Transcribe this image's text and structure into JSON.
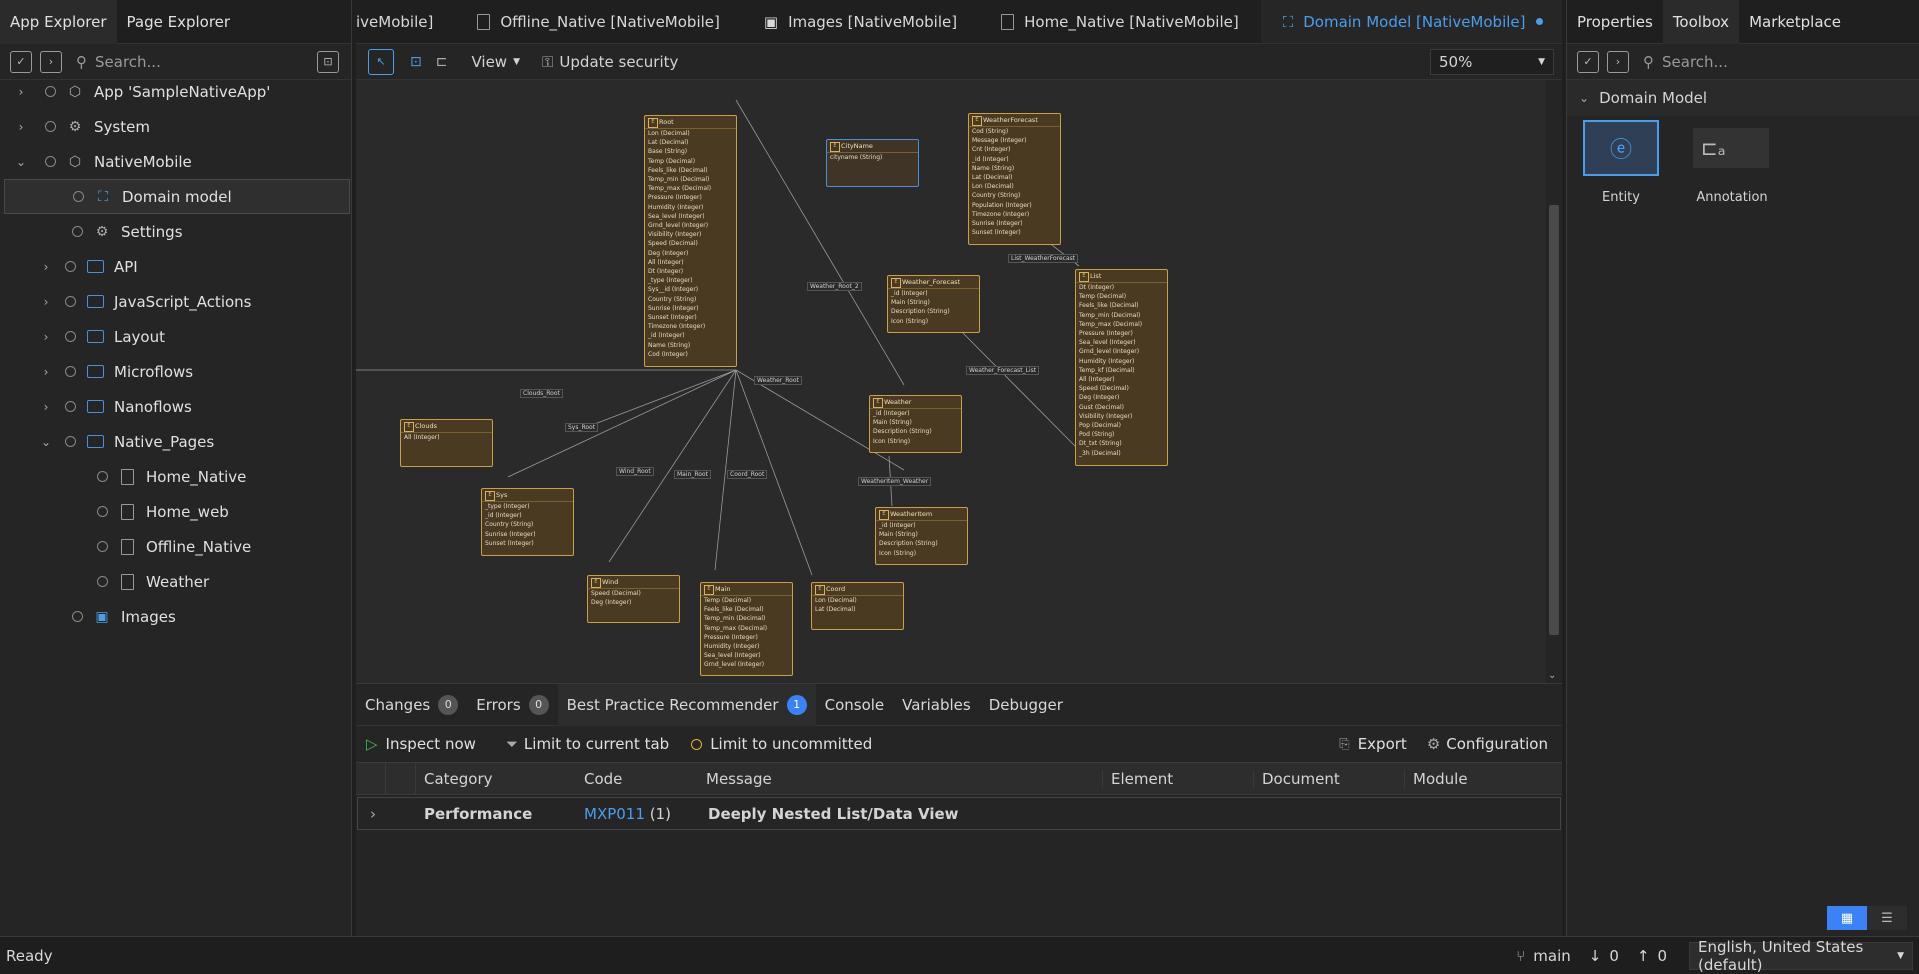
{
  "left_panel": {
    "tabs": [
      "App Explorer",
      "Page Explorer"
    ],
    "search_placeholder": "Search...",
    "tree": [
      {
        "label": "App 'SampleNativeApp'",
        "icon": "app-icon",
        "expanded": false
      },
      {
        "label": "System",
        "icon": "system-icon",
        "expanded": false
      },
      {
        "label": "NativeMobile",
        "icon": "module-icon",
        "expanded": true
      },
      {
        "label": "Domain model",
        "icon": "domain-model-icon",
        "selected": true
      },
      {
        "label": "Settings",
        "icon": "gear-icon"
      },
      {
        "label": "API",
        "icon": "folder-icon"
      },
      {
        "label": "JavaScript_Actions",
        "icon": "folder-icon"
      },
      {
        "label": "Layout",
        "icon": "folder-icon"
      },
      {
        "label": "Microflows",
        "icon": "folder-icon"
      },
      {
        "label": "Nanoflows",
        "icon": "folder-icon"
      },
      {
        "label": "Native_Pages",
        "icon": "folder-icon",
        "expanded": true
      },
      {
        "label": "Home_Native",
        "icon": "page-icon"
      },
      {
        "label": "Home_web",
        "icon": "page-icon"
      },
      {
        "label": "Offline_Native",
        "icon": "page-icon"
      },
      {
        "label": "Weather",
        "icon": "page-icon"
      },
      {
        "label": "Images",
        "icon": "image-collection-icon"
      }
    ]
  },
  "doc_tabs": [
    {
      "label": "iveMobile]",
      "active": false
    },
    {
      "label": "Offline_Native [NativeMobile]",
      "active": false
    },
    {
      "label": "Images [NativeMobile]",
      "active": false
    },
    {
      "label": "Home_Native [NativeMobile]",
      "active": false
    },
    {
      "label": "Domain Model [NativeMobile]",
      "active": true,
      "modified": true
    }
  ],
  "editor_toolbar": {
    "view": "View",
    "update_security": "Update security",
    "zoom": "50%"
  },
  "entities": [
    {
      "name": "Root",
      "attrs": [
        "Lon (Decimal)",
        "Lat (Decimal)",
        "Base (String)",
        "Temp (Decimal)",
        "Feels_like (Decimal)",
        "Temp_min (Decimal)",
        "Temp_max (Decimal)",
        "Pressure (Integer)",
        "Humidity (Integer)",
        "Sea_level (Integer)",
        "Grnd_level (Integer)",
        "Visibility (Integer)",
        "Speed (Decimal)",
        "Deg (Integer)",
        "All (Integer)",
        "Dt (Integer)",
        "_type (Integer)",
        "Sys__id (Integer)",
        "Country (String)",
        "Sunrise (Integer)",
        "Sunset (Integer)",
        "Timezone (Integer)",
        "_id (Integer)",
        "Name (String)",
        "Cod (Integer)"
      ]
    },
    {
      "name": "CityName",
      "attrs": [
        "cityname (String)"
      ],
      "selected": true
    },
    {
      "name": "WeatherForecast",
      "attrs": [
        "Cod (String)",
        "Message (Integer)",
        "Cnt (Integer)",
        "_id (Integer)",
        "Name (String)",
        "Lat (Decimal)",
        "Lon (Decimal)",
        "Country (String)",
        "Population (Integer)",
        "Timezone (Integer)",
        "Sunrise (Integer)",
        "Sunset (Integer)"
      ]
    },
    {
      "name": "Weather_Forecast",
      "attrs": [
        "_id (Integer)",
        "Main (String)",
        "Description (String)",
        "Icon (String)"
      ]
    },
    {
      "name": "List",
      "attrs": [
        "Dt (Integer)",
        "Temp (Decimal)",
        "Feels_like (Decimal)",
        "Temp_min (Decimal)",
        "Temp_max (Decimal)",
        "Pressure (Integer)",
        "Sea_level (Integer)",
        "Grnd_level (Integer)",
        "Humidity (Integer)",
        "Temp_kf (Decimal)",
        "All (Integer)",
        "Speed (Decimal)",
        "Deg (Integer)",
        "Gust (Decimal)",
        "Visibility (Integer)",
        "Pop (Decimal)",
        "Pod (String)",
        "Dt_txt (String)",
        "_3h (Decimal)"
      ]
    },
    {
      "name": "Clouds",
      "attrs": [
        "All (Integer)"
      ]
    },
    {
      "name": "Weather",
      "attrs": [
        "_id (Integer)",
        "Main (String)",
        "Description (String)",
        "Icon (String)"
      ]
    },
    {
      "name": "Sys",
      "attrs": [
        "_type (Integer)",
        "_id (Integer)",
        "Country (String)",
        "Sunrise (Integer)",
        "Sunset (Integer)"
      ]
    },
    {
      "name": "WeatherItem",
      "attrs": [
        "_id (Integer)",
        "Main (String)",
        "Description (String)",
        "Icon (String)"
      ]
    },
    {
      "name": "Wind",
      "attrs": [
        "Speed (Decimal)",
        "Deg (Integer)"
      ]
    },
    {
      "name": "Main",
      "attrs": [
        "Temp (Decimal)",
        "Feels_like (Decimal)",
        "Temp_min (Decimal)",
        "Temp_max (Decimal)",
        "Pressure (Integer)",
        "Humidity (Integer)",
        "Sea_level (Integer)",
        "Grnd_level (Integer)"
      ]
    },
    {
      "name": "Coord",
      "attrs": [
        "Lon (Decimal)",
        "Lat (Decimal)"
      ]
    }
  ],
  "associations": [
    "Weather_Root_2",
    "List_WeatherForecast",
    "Weather_Forecast_List",
    "Clouds_Root",
    "Weather_Root",
    "Sys_Root",
    "Wind_Root",
    "Main_Root",
    "Coord_Root",
    "WeatherItem_Weather"
  ],
  "bottom_panel": {
    "tabs": [
      {
        "label": "Changes",
        "count": "0"
      },
      {
        "label": "Errors",
        "count": "0"
      },
      {
        "label": "Best Practice Recommender",
        "count": "1",
        "active": true
      },
      {
        "label": "Console"
      },
      {
        "label": "Variables"
      },
      {
        "label": "Debugger"
      }
    ],
    "toolbar": {
      "inspect": "Inspect now",
      "limit_tab": "Limit to current tab",
      "limit_uncommitted": "Limit to uncommitted",
      "export": "Export",
      "configuration": "Configuration"
    },
    "columns": [
      "Category",
      "Code",
      "Message",
      "Element",
      "Document",
      "Module"
    ],
    "rows": [
      {
        "category": "Performance",
        "code": "MXP011",
        "code_count": "(1)",
        "message": "Deeply Nested List/Data View"
      }
    ]
  },
  "right_panel": {
    "tabs": [
      "Properties",
      "Toolbox",
      "Marketplace"
    ],
    "search_placeholder": "Search...",
    "section": "Domain Model",
    "tools": [
      {
        "label": "Entity"
      },
      {
        "label": "Annotation"
      }
    ]
  },
  "status_bar": {
    "status": "Ready",
    "branch": "main",
    "incoming": "0",
    "outgoing": "0",
    "language": "English, United States (default)"
  },
  "colors": {
    "accent": "#4a9eea",
    "entity_border": "#c9a04a",
    "entity_fill": "#4a3a22"
  }
}
